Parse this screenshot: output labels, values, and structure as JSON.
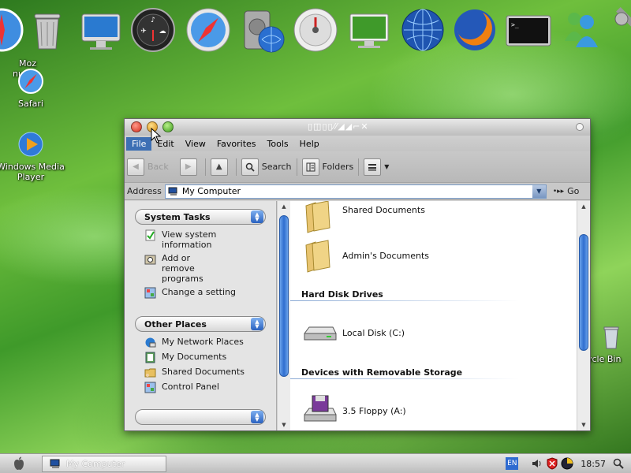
{
  "desktop": {
    "icons": [
      {
        "label": "Moz",
        "label2": "nund"
      },
      {
        "label": "Safari"
      },
      {
        "label": "Windows Media Player"
      },
      {
        "label": "ycle Bin"
      }
    ]
  },
  "window": {
    "title_glyphs": "▯◫▯▯⁄⁄◢◢⌐✕",
    "menu": [
      "File",
      "Edit",
      "View",
      "Favorites",
      "Tools",
      "Help"
    ],
    "toolbar": {
      "back": "Back",
      "search": "Search",
      "folders": "Folders"
    },
    "address": {
      "label": "Address",
      "value": "My Computer",
      "go": "Go"
    },
    "taskpane": {
      "system_tasks": {
        "title": "System Tasks",
        "items": [
          "View system information",
          "Add or remove programs",
          "Change a setting"
        ]
      },
      "other_places": {
        "title": "Other Places",
        "items": [
          "My Network Places",
          "My Documents",
          "Shared Documents",
          "Control Panel"
        ]
      }
    },
    "content": {
      "files": [
        "Shared Documents",
        "Admin's Documents"
      ],
      "hard_disk_group": "Hard Disk Drives",
      "hard_disks": [
        "Local Disk (C:)"
      ],
      "removable_group": "Devices with Removable Storage",
      "removable": [
        "3.5 Floppy (A:)"
      ]
    }
  },
  "taskbar": {
    "task": "My Computer",
    "lang": "EN",
    "clock": "18:57"
  }
}
